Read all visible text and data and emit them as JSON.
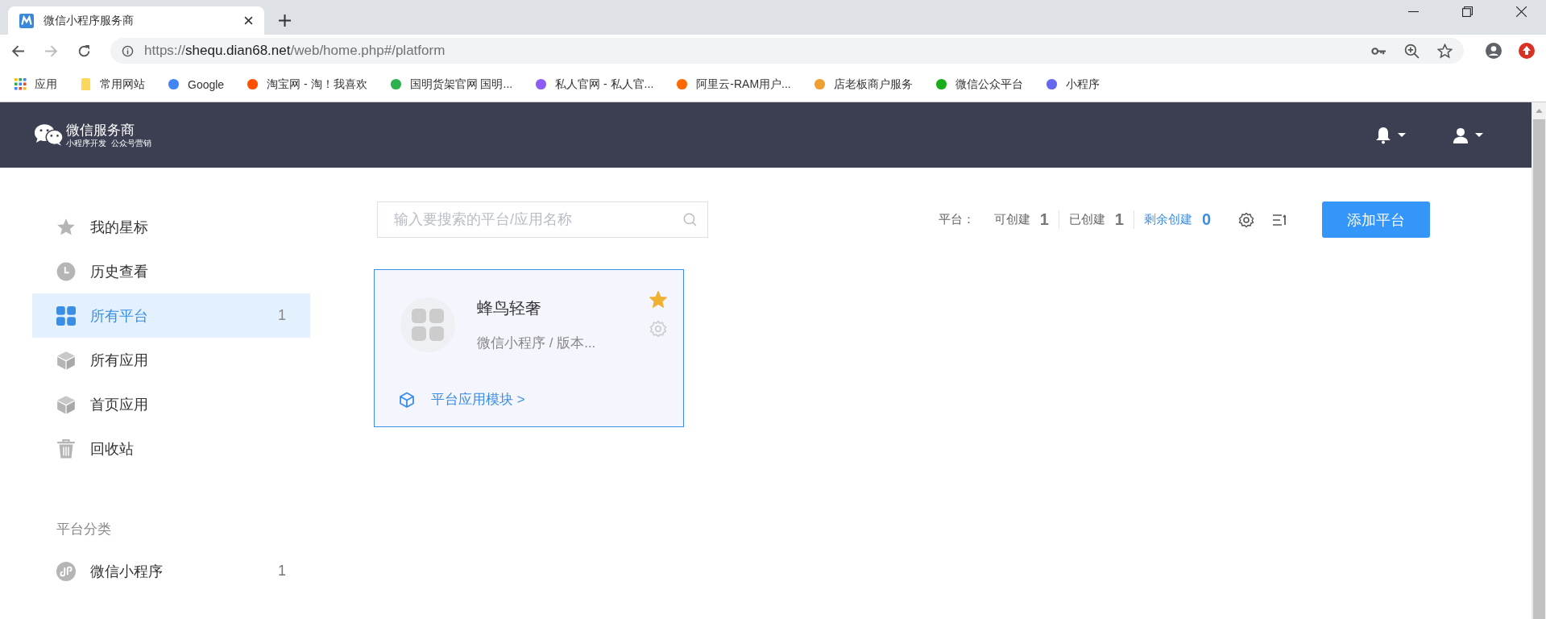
{
  "browser": {
    "tab": {
      "title": "微信小程序服务商"
    },
    "url": {
      "scheme": "https://",
      "host": "shequ.dian68.net",
      "path": "/web/home.php#/platform"
    },
    "bookmarks": [
      {
        "label": "应用",
        "kind": "apps"
      },
      {
        "label": "常用网站",
        "kind": "folder",
        "color": "#fbd75b"
      },
      {
        "label": "Google",
        "kind": "site",
        "color": "#4285f4"
      },
      {
        "label": "淘宝网 - 淘！我喜欢",
        "kind": "site",
        "color": "#ff5000"
      },
      {
        "label": "国明货架官网 国明...",
        "kind": "site",
        "color": "#2bb24c"
      },
      {
        "label": "私人官网 - 私人官...",
        "kind": "site",
        "color": "#8e5cf7"
      },
      {
        "label": "阿里云-RAM用户...",
        "kind": "site",
        "color": "#ff6a00"
      },
      {
        "label": "店老板商户服务",
        "kind": "site",
        "color": "#f0a030"
      },
      {
        "label": "微信公众平台",
        "kind": "site",
        "color": "#1aad19"
      },
      {
        "label": "小程序",
        "kind": "site",
        "color": "#6467f0"
      }
    ]
  },
  "header": {
    "logo_title": "微信服务商",
    "logo_subtitle": "小程序开发  公众号营销"
  },
  "sidebar": {
    "items": [
      {
        "label": "我的星标",
        "kind": "star",
        "selected": false
      },
      {
        "label": "历史查看",
        "kind": "clock",
        "selected": false
      },
      {
        "label": "所有平台",
        "kind": "grid",
        "selected": true,
        "count": "1"
      },
      {
        "label": "所有应用",
        "kind": "cube",
        "selected": false
      },
      {
        "label": "首页应用",
        "kind": "cube",
        "selected": false
      },
      {
        "label": "回收站",
        "kind": "trash",
        "selected": false
      }
    ],
    "section_title": "平台分类",
    "categories": [
      {
        "label": "微信小程序",
        "count": "1"
      }
    ]
  },
  "toolbar": {
    "search": {
      "placeholder": "输入要搜索的平台/应用名称"
    },
    "stats_label": "平台：",
    "stats": [
      {
        "label": "可创建",
        "value": "1",
        "highlight": false
      },
      {
        "label": "已创建",
        "value": "1",
        "highlight": false
      },
      {
        "label": "剩余创建",
        "value": "0",
        "highlight": true
      }
    ],
    "add_button": "添加平台"
  },
  "cards": [
    {
      "title": "蜂鸟轻奢",
      "subtitle": "微信小程序 / 版本...",
      "starred": true,
      "link": "平台应用模块 >"
    }
  ]
}
